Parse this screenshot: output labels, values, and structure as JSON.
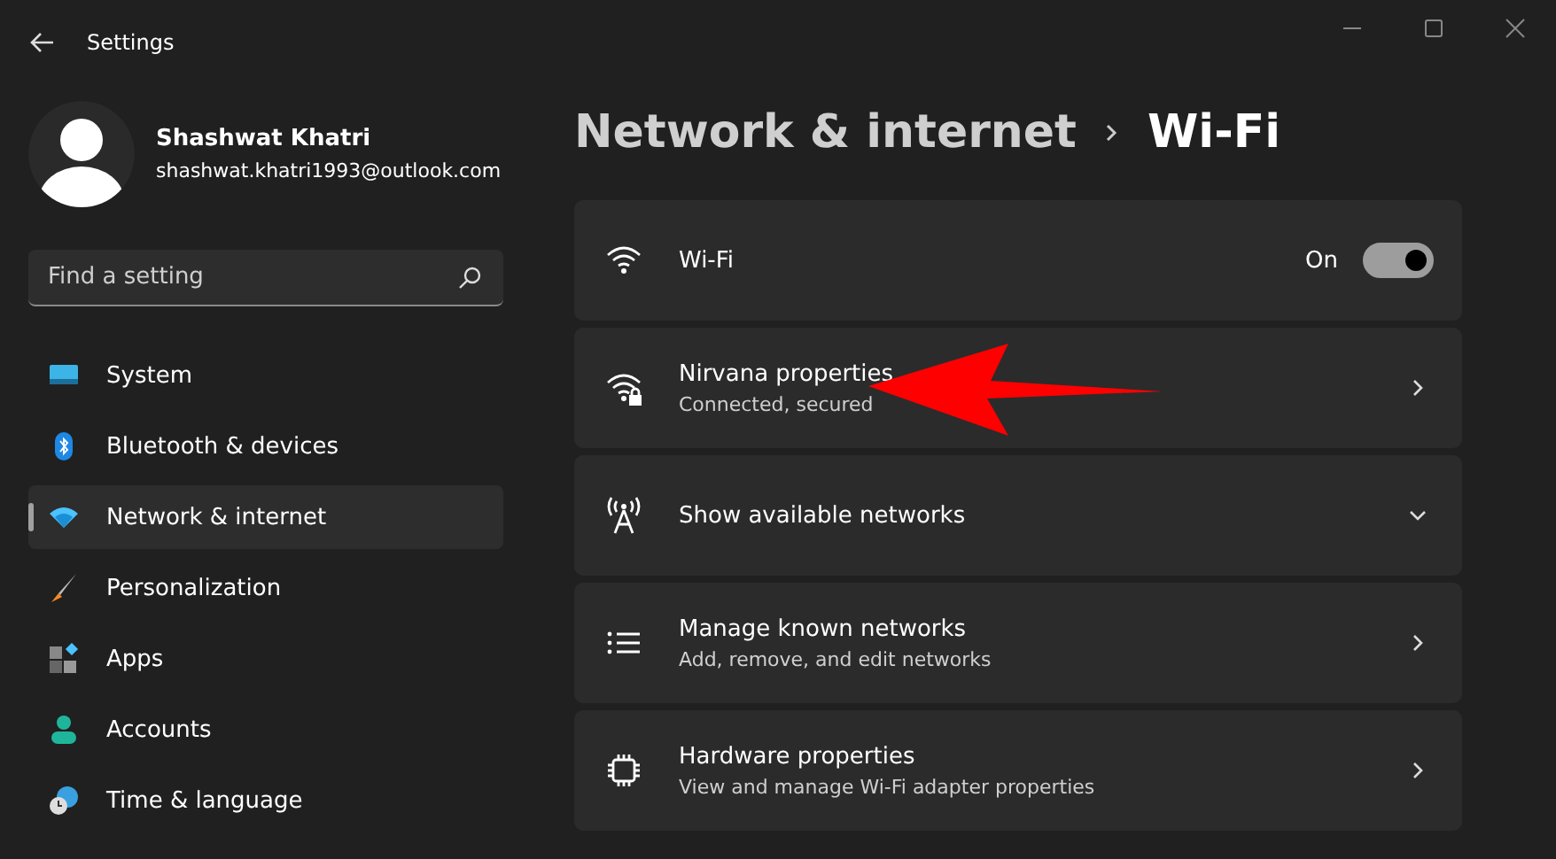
{
  "window": {
    "title": "Settings"
  },
  "user": {
    "name": "Shashwat Khatri",
    "email": "shashwat.khatri1993@outlook.com"
  },
  "search": {
    "placeholder": "Find a setting"
  },
  "nav": [
    {
      "label": "System",
      "selected": false
    },
    {
      "label": "Bluetooth & devices",
      "selected": false
    },
    {
      "label": "Network & internet",
      "selected": true
    },
    {
      "label": "Personalization",
      "selected": false
    },
    {
      "label": "Apps",
      "selected": false
    },
    {
      "label": "Accounts",
      "selected": false
    },
    {
      "label": "Time & language",
      "selected": false
    }
  ],
  "breadcrumb": [
    {
      "label": "Network & internet",
      "current": false
    },
    {
      "label": "Wi-Fi",
      "current": true
    }
  ],
  "cards": [
    {
      "kind": "toggle",
      "title": "Wi-Fi",
      "state_label": "On",
      "on": true
    },
    {
      "kind": "link",
      "title": "Nirvana properties",
      "subtitle": "Connected, secured"
    },
    {
      "kind": "expand",
      "title": "Show available networks",
      "expanded": false
    },
    {
      "kind": "link",
      "title": "Manage known networks",
      "subtitle": "Add, remove, and edit networks"
    },
    {
      "kind": "link",
      "title": "Hardware properties",
      "subtitle": "View and manage Wi-Fi adapter properties"
    }
  ]
}
